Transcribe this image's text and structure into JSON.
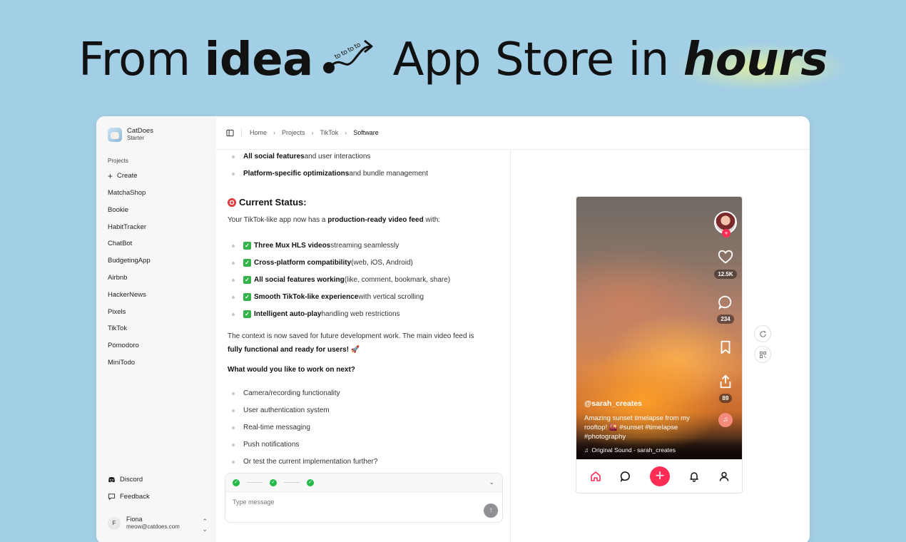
{
  "hero": {
    "from": "From",
    "idea": "idea",
    "connector": "to to to to",
    "app_store": "App Store in",
    "hours": "hours"
  },
  "sidebar": {
    "brand_name": "CatDoes",
    "brand_plan": "Starter",
    "section_label": "Projects",
    "create_label": "Create",
    "projects": [
      "MatchaShop",
      "Bookie",
      "HabitTracker",
      "ChatBot",
      "BudgetingApp",
      "Airbnb",
      "HackerNews",
      "Pixels",
      "TikTok",
      "Pomodoro",
      "MiniTodo"
    ],
    "discord_label": "Discord",
    "feedback_label": "Feedback",
    "user": {
      "initial": "F",
      "name": "Fiona",
      "email": "meow@catdoes.com"
    }
  },
  "breadcrumb": [
    "Home",
    "Projects",
    "TikTok",
    "Software"
  ],
  "chat": {
    "top_bullets": [
      {
        "bold": "All social features",
        "rest": " and user interactions"
      },
      {
        "bold": "Platform-specific optimizations",
        "rest": " and bundle management"
      }
    ],
    "status_heading": "Current Status:",
    "intro_pre": "Your TikTok-like app now has a ",
    "intro_bold": "production-ready video feed",
    "intro_post": " with:",
    "checks": [
      {
        "bold": "Three Mux HLS videos",
        "rest": " streaming seamlessly"
      },
      {
        "bold": "Cross-platform compatibility",
        "rest": " (web, iOS, Android)"
      },
      {
        "bold": "All social features working",
        "rest": " (like, comment, bookmark, share)"
      },
      {
        "bold": "Smooth TikTok-like experience",
        "rest": " with vertical scrolling"
      },
      {
        "bold": "Intelligent auto-play",
        "rest": " handling web restrictions"
      }
    ],
    "context_line1": "The context is now saved for future development work. The main video feed is",
    "context_bold": "fully functional and ready for users!",
    "context_emoji": "🚀",
    "question": "What would you like to work on next?",
    "next_items": [
      "Camera/recording functionality",
      "User authentication system",
      "Real-time messaging",
      "Push notifications",
      "Or test the current implementation further?"
    ],
    "composer_placeholder": "Type message"
  },
  "preview": {
    "likes": "12.5K",
    "comments": "234",
    "shares": "89",
    "handle": "@sarah_creates",
    "caption": "Amazing sunset timelapse from my rooftop! 🌇 #sunset #timelapse #photography",
    "sound": "Original Sound - sarah_creates",
    "colors": {
      "accent": "#fe2c55",
      "home_active": "#fe2c55"
    }
  }
}
